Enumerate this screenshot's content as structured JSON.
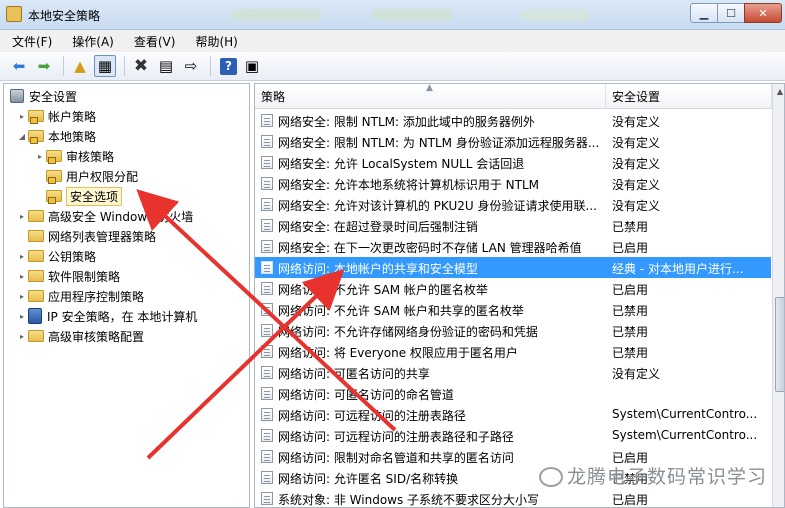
{
  "window": {
    "title": "本地安全策略"
  },
  "menu": [
    "文件(F)",
    "操作(A)",
    "查看(V)",
    "帮助(H)"
  ],
  "toolbar": {
    "back_icon": "arrow-left-icon",
    "forward_icon": "arrow-right-icon",
    "help_label": "?"
  },
  "tree": {
    "root": "安全设置",
    "items": [
      {
        "label": "帐户策略",
        "level": 1,
        "expander": "▸"
      },
      {
        "label": "本地策略",
        "level": 1,
        "expander": "◢"
      },
      {
        "label": "审核策略",
        "level": 2,
        "expander": "▸"
      },
      {
        "label": "用户权限分配",
        "level": 2,
        "expander": ""
      },
      {
        "label": "安全选项",
        "level": 2,
        "expander": ""
      },
      {
        "label": "高级安全 Windows 防火墙",
        "level": 1,
        "expander": "▸"
      },
      {
        "label": "网络列表管理器策略",
        "level": 1,
        "expander": ""
      },
      {
        "label": "公钥策略",
        "level": 1,
        "expander": "▸"
      },
      {
        "label": "软件限制策略",
        "level": 1,
        "expander": "▸"
      },
      {
        "label": "应用程序控制策略",
        "level": 1,
        "expander": "▸"
      },
      {
        "label": "IP 安全策略，在 本地计算机",
        "level": 1,
        "expander": "▸"
      },
      {
        "label": "高级审核策略配置",
        "level": 1,
        "expander": "▸"
      }
    ]
  },
  "list": {
    "col_policy": "策略",
    "col_setting": "安全设置",
    "rows": [
      {
        "policy": "网络安全: 限制 NTLM: 添加此域中的服务器例外",
        "setting": "没有定义"
      },
      {
        "policy": "网络安全: 限制 NTLM: 为 NTLM 身份验证添加远程服务器...",
        "setting": "没有定义"
      },
      {
        "policy": "网络安全: 允许 LocalSystem NULL 会话回退",
        "setting": "没有定义"
      },
      {
        "policy": "网络安全: 允许本地系统将计算机标识用于 NTLM",
        "setting": "没有定义"
      },
      {
        "policy": "网络安全: 允许对该计算机的 PKU2U 身份验证请求使用联...",
        "setting": "没有定义"
      },
      {
        "policy": "网络安全: 在超过登录时间后强制注销",
        "setting": "已禁用"
      },
      {
        "policy": "网络安全: 在下一次更改密码时不存储 LAN 管理器哈希值",
        "setting": "已启用"
      },
      {
        "policy": "网络访问: 本地帐户的共享和安全模型",
        "setting": "经典 - 对本地用户进行..."
      },
      {
        "policy": "网络访问: 不允许 SAM 帐户的匿名枚举",
        "setting": "已启用"
      },
      {
        "policy": "网络访问: 不允许 SAM 帐户和共享的匿名枚举",
        "setting": "已禁用"
      },
      {
        "policy": "网络访问: 不允许存储网络身份验证的密码和凭据",
        "setting": "已禁用"
      },
      {
        "policy": "网络访问: 将 Everyone 权限应用于匿名用户",
        "setting": "已禁用"
      },
      {
        "policy": "网络访问: 可匿名访问的共享",
        "setting": "没有定义"
      },
      {
        "policy": "网络访问: 可匿名访问的命名管道",
        "setting": ""
      },
      {
        "policy": "网络访问: 可远程访问的注册表路径",
        "setting": "System\\CurrentContro..."
      },
      {
        "policy": "网络访问: 可远程访问的注册表路径和子路径",
        "setting": "System\\CurrentContro..."
      },
      {
        "policy": "网络访问: 限制对命名管道和共享的匿名访问",
        "setting": "已启用"
      },
      {
        "policy": "网络访问: 允许匿名 SID/名称转换",
        "setting": "已禁用"
      },
      {
        "policy": "系统对象: 非 Windows 子系统不要求区分大小写",
        "setting": "已启用"
      }
    ]
  },
  "watermark": {
    "text": "龙腾电子数码常识学习"
  },
  "colors": {
    "selection": "#3399ff",
    "annotation_arrow": "#e8322d"
  }
}
